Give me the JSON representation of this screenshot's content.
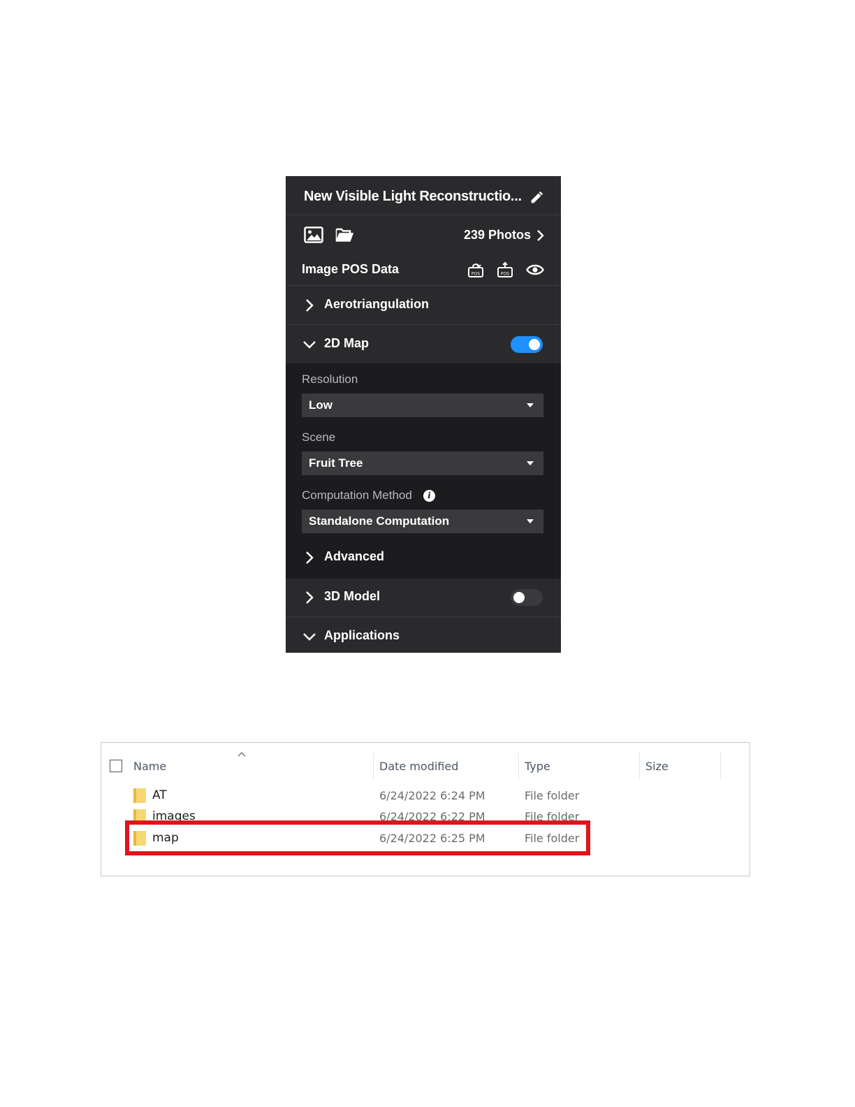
{
  "panel": {
    "title": "New Visible Light Reconstructio...",
    "photos_count": "239 Photos",
    "image_pos_label": "Image POS Data",
    "pos_icon_text": "POS",
    "sections": {
      "aerotriangulation": "Aerotriangulation",
      "map2d": "2D Map",
      "model3d": "3D Model",
      "applications": "Applications"
    },
    "map2d_enabled": true,
    "model3d_enabled": false,
    "fields": {
      "resolution_label": "Resolution",
      "resolution_value": "Low",
      "scene_label": "Scene",
      "scene_value": "Fruit Tree",
      "method_label": "Computation Method",
      "method_value": "Standalone Computation",
      "info_glyph": "i",
      "advanced_label": "Advanced"
    },
    "colors": {
      "accent": "#1e90ff",
      "panel_bg": "#2a2a2c",
      "section_bg": "#1c1c1e",
      "toggle_off": "#3a3a3d"
    }
  },
  "explorer": {
    "columns": {
      "name": "Name",
      "date": "Date modified",
      "type": "Type",
      "size": "Size"
    },
    "rows": [
      {
        "name": "AT",
        "date": "6/24/2022 6:24 PM",
        "type": "File folder"
      },
      {
        "name": "images",
        "date": "6/24/2022 6:22 PM",
        "type": "File folder"
      },
      {
        "name": "map",
        "date": "6/24/2022 6:25 PM",
        "type": "File folder"
      }
    ],
    "highlight_color": "#e0141b"
  }
}
